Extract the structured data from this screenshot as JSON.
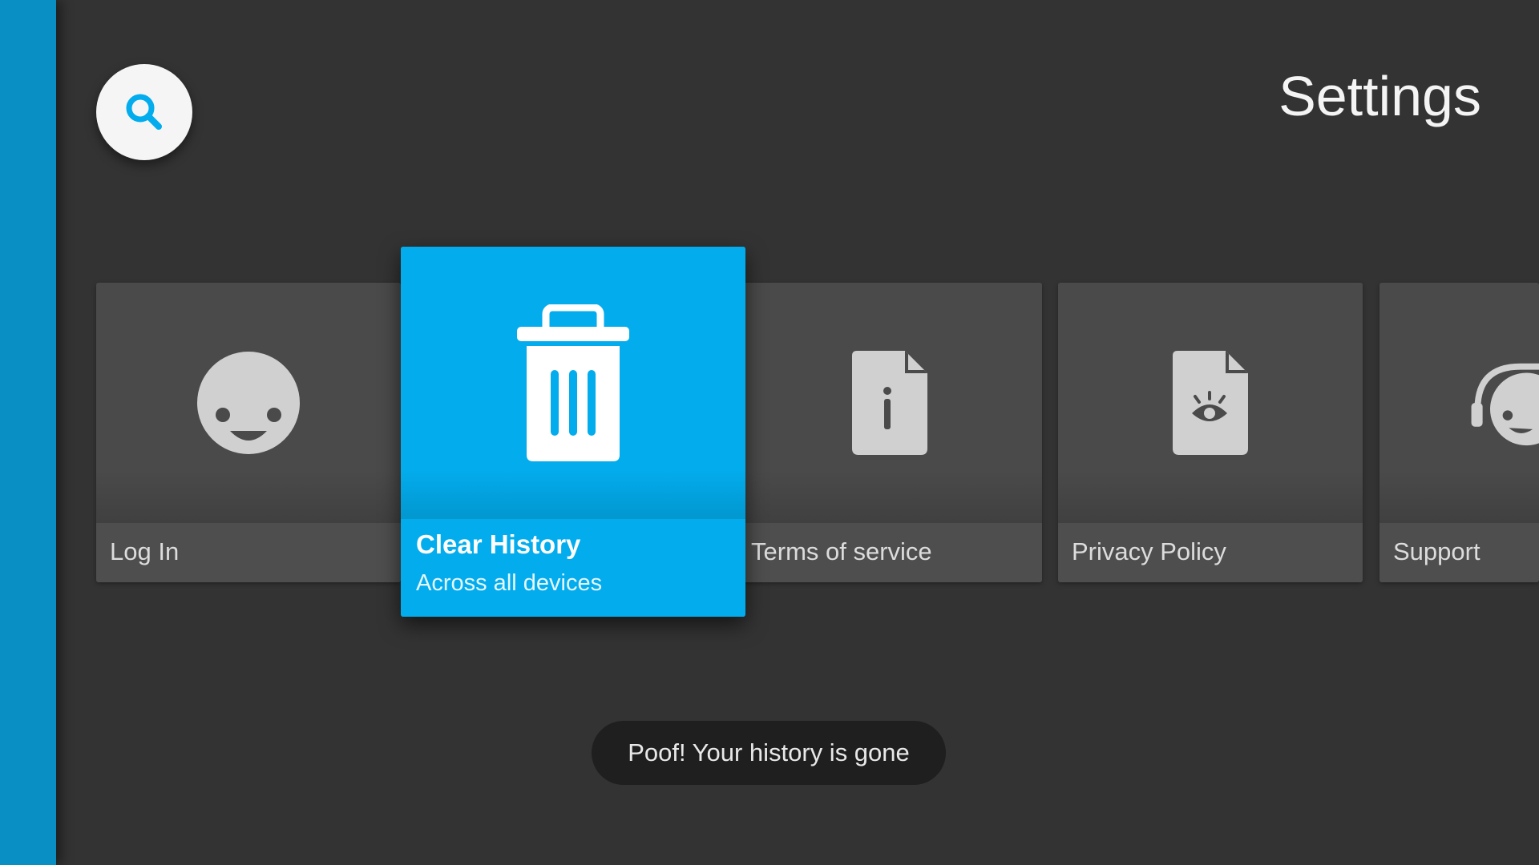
{
  "header": {
    "title": "Settings",
    "search_icon": "search-icon"
  },
  "cards": [
    {
      "label": "Log In",
      "icon": "smiley-face-icon"
    },
    {
      "label": "Clear History",
      "sublabel": "Across all devices",
      "icon": "trash-icon",
      "selected": true
    },
    {
      "label": "Terms of service",
      "icon": "info-document-icon"
    },
    {
      "label": "Privacy Policy",
      "icon": "eye-document-icon"
    },
    {
      "label": "Support",
      "icon": "headset-icon"
    }
  ],
  "toast": {
    "message": "Poof! Your history is gone"
  },
  "colors": {
    "accent": "#03aced",
    "side_rail": "#0a8fc5",
    "background": "#333333",
    "card": "#4a4a4a",
    "icon_gray": "#d0d0d0"
  }
}
